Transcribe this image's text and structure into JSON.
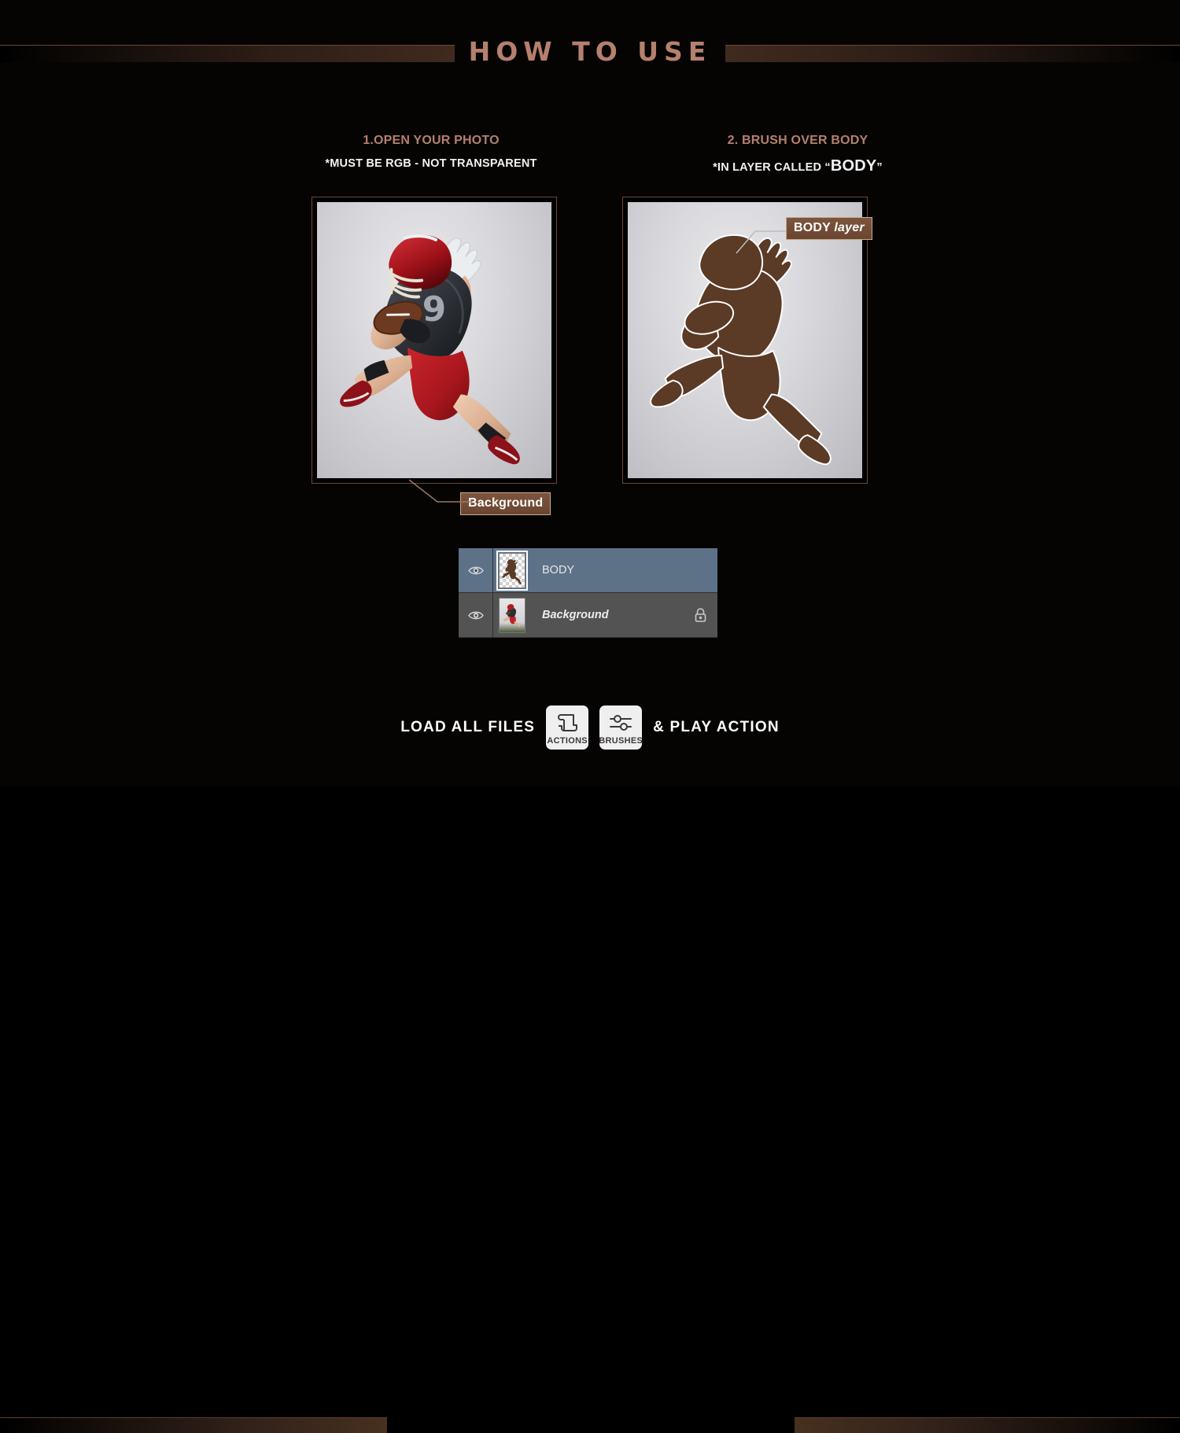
{
  "header": {
    "title": "HOW TO USE",
    "accent_color": "#b5806d",
    "bar_color": "#402a1e"
  },
  "steps": [
    {
      "title": "1.OPEN YOUR PHOTO",
      "subtitle": "*MUST BE RGB - NOT TRANSPARENT",
      "image_alt": "football-player-photo"
    },
    {
      "title": "2. BRUSH OVER BODY",
      "subtitle_prefix": "*IN LAYER CALLED “",
      "subtitle_emphasis": "BODY",
      "subtitle_suffix": "”",
      "image_alt": "football-player-silhouette"
    }
  ],
  "callouts": {
    "background": "Background",
    "body_layer_bold": "BODY",
    "body_layer_italic": "layer"
  },
  "layers_panel": {
    "rows": [
      {
        "name": "BODY",
        "selected": true,
        "visible": true,
        "locked": false,
        "thumb": "transparent-silhouette-thumbnail",
        "visibility_icon": "eye-icon"
      },
      {
        "name": "Background",
        "selected": false,
        "visible": true,
        "locked": true,
        "thumb": "photo-thumbnail",
        "visibility_icon": "eye-icon",
        "lock_icon": "lock-icon"
      }
    ],
    "selected_row_color": "#5d7187",
    "row_color": "#535353"
  },
  "footer": {
    "left_label": "LOAD ALL FILES",
    "right_label": "& PLAY ACTION",
    "buttons": [
      {
        "caption": "ACTIONS",
        "icon": "scroll-icon"
      },
      {
        "caption": "BRUSHES",
        "icon": "sliders-icon"
      }
    ]
  }
}
